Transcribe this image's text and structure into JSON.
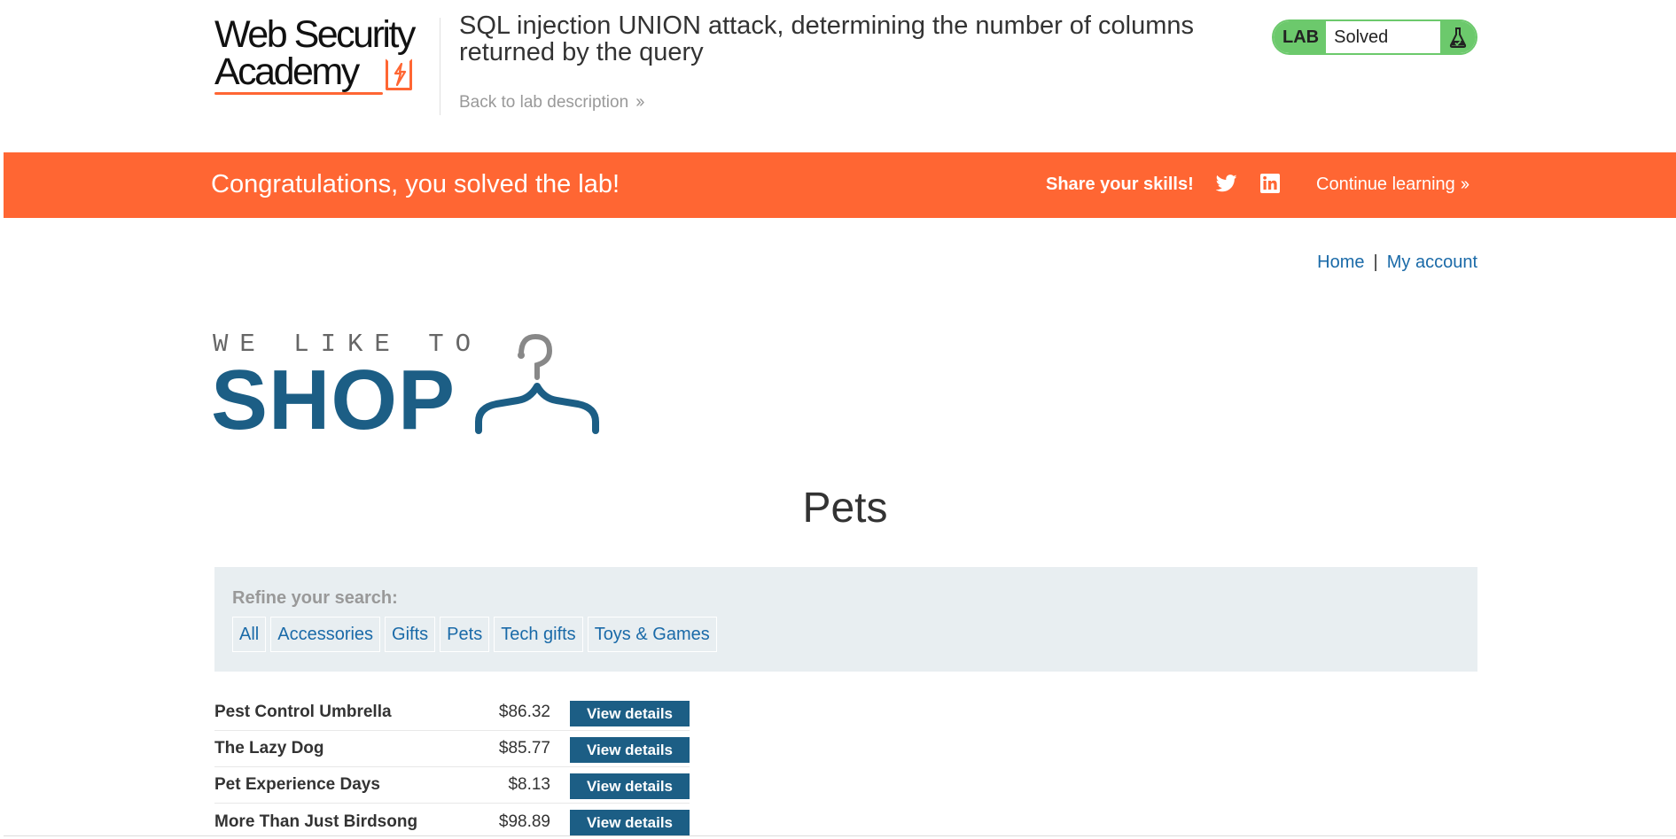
{
  "header": {
    "logo_line1": "Web Security",
    "logo_line2": "Academy",
    "lab_title": "SQL injection UNION attack, determining the number of columns returned by the query",
    "back_link": "Back to lab description",
    "status_lab": "LAB",
    "status_state": "Solved",
    "flask_icon": "flask-icon"
  },
  "banner": {
    "message": "Congratulations, you solved the lab!",
    "share": "Share your skills!",
    "twitter_icon": "twitter-icon",
    "linkedin_icon": "linkedin-icon",
    "continue": "Continue learning",
    "bg_color": "#ff6633"
  },
  "topnav": {
    "home": "Home",
    "separator": "|",
    "account": "My account"
  },
  "shop_logo": {
    "tagline": "WE LIKE TO",
    "word": "SHOP",
    "icon": "hanger-icon"
  },
  "page_title": "Pets",
  "filters": {
    "label": "Refine your search:",
    "categories": [
      "All",
      "Accessories",
      "Gifts",
      "Pets",
      "Tech gifts",
      "Toys & Games"
    ]
  },
  "products": [
    {
      "name": "Pest Control Umbrella",
      "price": "$86.32",
      "button": "View details"
    },
    {
      "name": "The Lazy Dog",
      "price": "$85.77",
      "button": "View details"
    },
    {
      "name": "Pet Experience Days",
      "price": "$8.13",
      "button": "View details"
    },
    {
      "name": "More Than Just Birdsong",
      "price": "$98.89",
      "button": "View details"
    }
  ]
}
